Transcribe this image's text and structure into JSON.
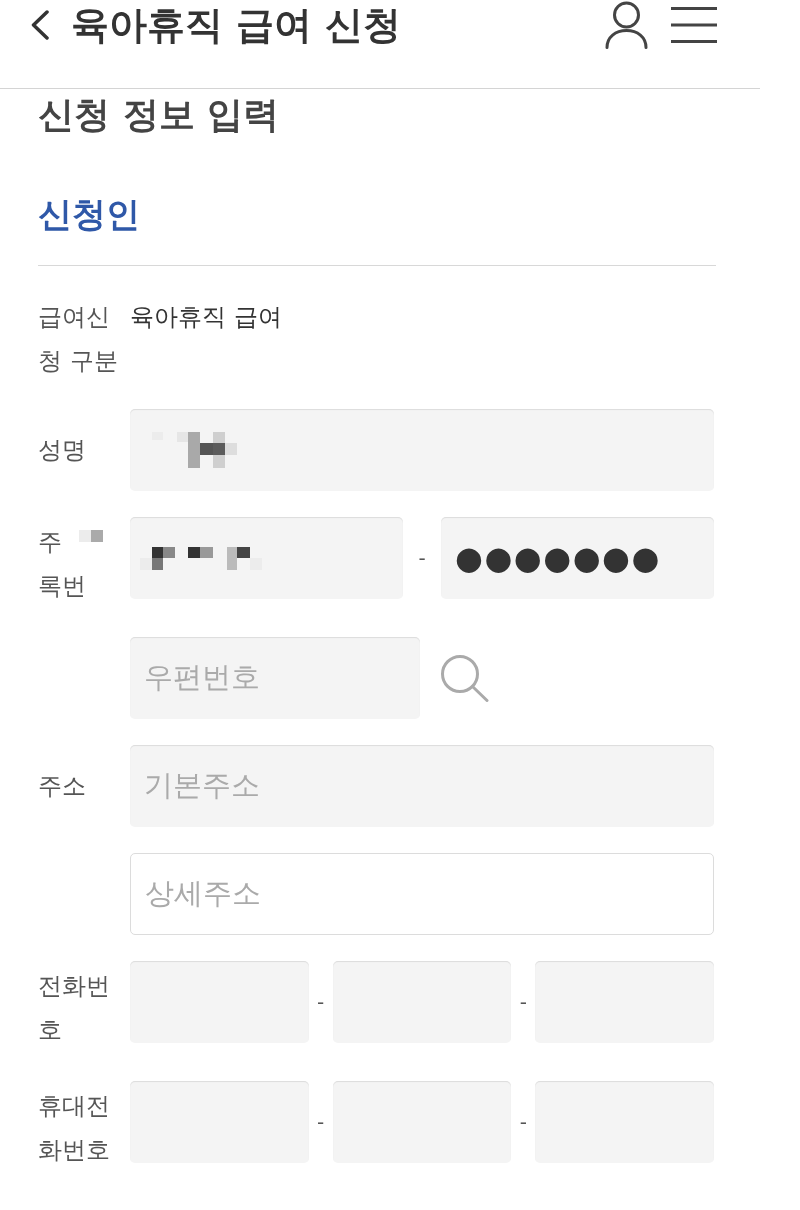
{
  "header": {
    "title": "육아휴직 급여 신청"
  },
  "section_title": "신청 정보 입력",
  "group_title": "신청인",
  "rows": [
    {
      "kind": "text",
      "label": "급여신청 구분",
      "value": "육아휴직 급여"
    },
    {
      "kind": "fields",
      "label": "성명",
      "parts": [
        {
          "kind": "field",
          "readonly": true,
          "redacted": true
        }
      ]
    },
    {
      "kind": "fields",
      "label_lines": [
        "주",
        "록번"
      ],
      "label_redacted": true,
      "parts": [
        {
          "kind": "field",
          "readonly": true,
          "redacted": true
        },
        {
          "kind": "separator",
          "text": "-"
        },
        {
          "kind": "field",
          "readonly": true,
          "redacted": false,
          "value": "●●●●●●●"
        }
      ]
    },
    {
      "kind": "postcode",
      "parts": [
        {
          "kind": "field",
          "readonly": true,
          "redacted": false,
          "placeholder": "우편번호"
        }
      ]
    },
    {
      "kind": "fields",
      "label": "주소",
      "parts": [
        {
          "kind": "field",
          "readonly": true,
          "redacted": false,
          "placeholder": "기본주소"
        }
      ]
    },
    {
      "kind": "fields",
      "parts": [
        {
          "kind": "field",
          "readonly": false,
          "redacted": false,
          "placeholder": "상세주소"
        }
      ]
    },
    {
      "kind": "fields",
      "label": "전화번호",
      "parts": [
        {
          "kind": "field",
          "readonly": true,
          "redacted": false
        },
        {
          "kind": "separator",
          "text": "-"
        },
        {
          "kind": "field",
          "readonly": true,
          "redacted": false
        },
        {
          "kind": "separator",
          "text": "-"
        },
        {
          "kind": "field",
          "readonly": true,
          "redacted": false
        }
      ]
    },
    {
      "kind": "fields",
      "label": "휴대전화번호",
      "parts": [
        {
          "kind": "field",
          "readonly": true,
          "redacted": false
        },
        {
          "kind": "separator",
          "text": "-"
        },
        {
          "kind": "field",
          "readonly": true,
          "redacted": false
        },
        {
          "kind": "separator",
          "text": "-"
        },
        {
          "kind": "field",
          "readonly": true,
          "redacted": false
        }
      ]
    }
  ]
}
